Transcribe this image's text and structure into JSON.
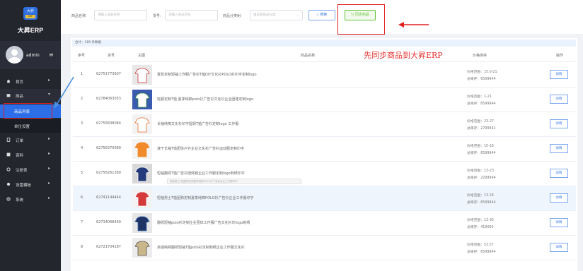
{
  "app": {
    "logo_text": "大昇",
    "logo_sub": "ERP",
    "brand": "大昇ERP",
    "username": "admin",
    "menu_toggle_glyph": "≡"
  },
  "sidebar": {
    "items": [
      {
        "label": "首页",
        "expanded": false
      },
      {
        "label": "商品",
        "expanded": true,
        "children": [
          {
            "label": "商品列表",
            "active": true
          },
          {
            "label": "单位设置",
            "active": false
          }
        ]
      },
      {
        "label": "订单",
        "expanded": false
      },
      {
        "label": "资料",
        "expanded": false
      },
      {
        "label": "注册表",
        "expanded": false
      },
      {
        "label": "设置模板",
        "expanded": false
      },
      {
        "label": "系统",
        "expanded": false
      }
    ]
  },
  "filters": {
    "name_label": "商品名称:",
    "name_placeholder": "请输入商品名称",
    "code_label": "货号:",
    "code_placeholder": "请输入商品货号",
    "category_label": "商品分类树:",
    "category_placeholder": "请选择商品分类",
    "search_label": "搜索",
    "sync_label": "同步商品"
  },
  "table": {
    "total_text": "合计：189 条数据",
    "headers": [
      "序号",
      "货号",
      "主图",
      "商品名称",
      "价格库存",
      "操作"
    ],
    "price_prefix": "价格范围：",
    "stock_prefix": "总库存：",
    "edit_label": "详情",
    "rows": [
      {
        "index": "1",
        "code": "62751773607",
        "name": "夏款定制短袖工作服广告衫T恤DIY文化衫POLO衫印字定制logo",
        "price": "15.0-21",
        "stock": "6599944",
        "thumb": "white-polo"
      },
      {
        "index": "2",
        "code": "62784063053",
        "name": "班服定制T恤 夏季纯棉polo衫广告衫文化衫企业团建定制logo",
        "price": "1-21",
        "stock": "6599944",
        "thumb": "team-polo"
      },
      {
        "index": "3",
        "code": "62755838084",
        "name": "长袖纯棉文化衫印字圆领T恤广告衫定制logo 工作服",
        "price": "23-27",
        "stock": "2799942",
        "thumb": "longsleeve-white"
      },
      {
        "index": "4",
        "code": "62756370089",
        "name": "速干长袖T恤团体户外企业文化衫广告衫运动服定制印字",
        "price": "15-16",
        "stock": "6599944",
        "thumb": "longsleeve-orange"
      },
      {
        "index": "5",
        "code": "62758261380",
        "name": "短袖翻领T恤广告衫团体服企业工作服定制logo刺绣印字",
        "price": "13-23",
        "stock": "2299994",
        "thumb": "group-polo"
      },
      {
        "index": "6",
        "code": "62741144444",
        "name": "短袖男士T恤团购定制夏季纯棉POLO衫广告衫企业工作服印字",
        "price": "13.28",
        "stock": "6599944",
        "thumb": "red-polo"
      },
      {
        "index": "7",
        "code": "62734068469",
        "name": "翻领短袖polo衫定制企业团体工作服广告文化衫印logo刺绣",
        "price": "13-35",
        "stock": "419000",
        "thumb": "navy-polo"
      },
      {
        "index": "8",
        "code": "62721704187",
        "name": "高端纯棉翻领短袖T恤polo衫定制刺绣企业工作服文化衫",
        "price": "53.57",
        "stock": "6599944",
        "thumb": "khaki-polo"
      }
    ],
    "tooltip_text": "短袖男士T恤团购定制夏季纯棉POLO衫广告衫企业工作服印字"
  },
  "annotation": {
    "text": "先同步商品到大昇ERP"
  },
  "colors": {
    "sidebar_bg": "#24262e",
    "active_menu": "#2b6ee8",
    "annotation_red": "#e02020",
    "sync_green": "#67c23a",
    "link_blue": "#3a7be6"
  }
}
